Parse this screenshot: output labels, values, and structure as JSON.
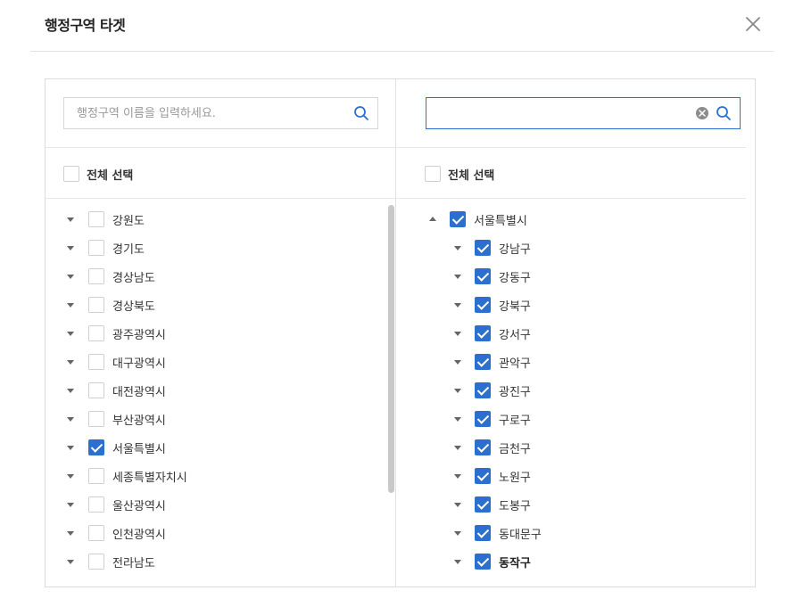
{
  "modal": {
    "title": "행정구역 타겟"
  },
  "left_pane": {
    "search_placeholder": "행정구역 이름을 입력하세요.",
    "search_value": "",
    "select_all_label": "전체 선택",
    "items": [
      {
        "label": "강원도",
        "checked": false
      },
      {
        "label": "경기도",
        "checked": false
      },
      {
        "label": "경상남도",
        "checked": false
      },
      {
        "label": "경상북도",
        "checked": false
      },
      {
        "label": "광주광역시",
        "checked": false
      },
      {
        "label": "대구광역시",
        "checked": false
      },
      {
        "label": "대전광역시",
        "checked": false
      },
      {
        "label": "부산광역시",
        "checked": false
      },
      {
        "label": "서울특별시",
        "checked": true
      },
      {
        "label": "세종특별자치시",
        "checked": false
      },
      {
        "label": "울산광역시",
        "checked": false
      },
      {
        "label": "인천광역시",
        "checked": false
      },
      {
        "label": "전라남도",
        "checked": false
      }
    ]
  },
  "right_pane": {
    "search_placeholder": "",
    "search_value": "",
    "select_all_label": "전체 선택",
    "parent": {
      "label": "서울특별시",
      "checked": true,
      "expanded": true
    },
    "children": [
      {
        "label": "강남구",
        "checked": true
      },
      {
        "label": "강동구",
        "checked": true
      },
      {
        "label": "강북구",
        "checked": true
      },
      {
        "label": "강서구",
        "checked": true
      },
      {
        "label": "관악구",
        "checked": true
      },
      {
        "label": "광진구",
        "checked": true
      },
      {
        "label": "구로구",
        "checked": true
      },
      {
        "label": "금천구",
        "checked": true
      },
      {
        "label": "노원구",
        "checked": true
      },
      {
        "label": "도봉구",
        "checked": true
      },
      {
        "label": "동대문구",
        "checked": true
      },
      {
        "label": "동작구",
        "checked": true,
        "bold": true
      }
    ]
  },
  "colors": {
    "accent": "#2b6fd1",
    "border": "#dcdcdc"
  }
}
